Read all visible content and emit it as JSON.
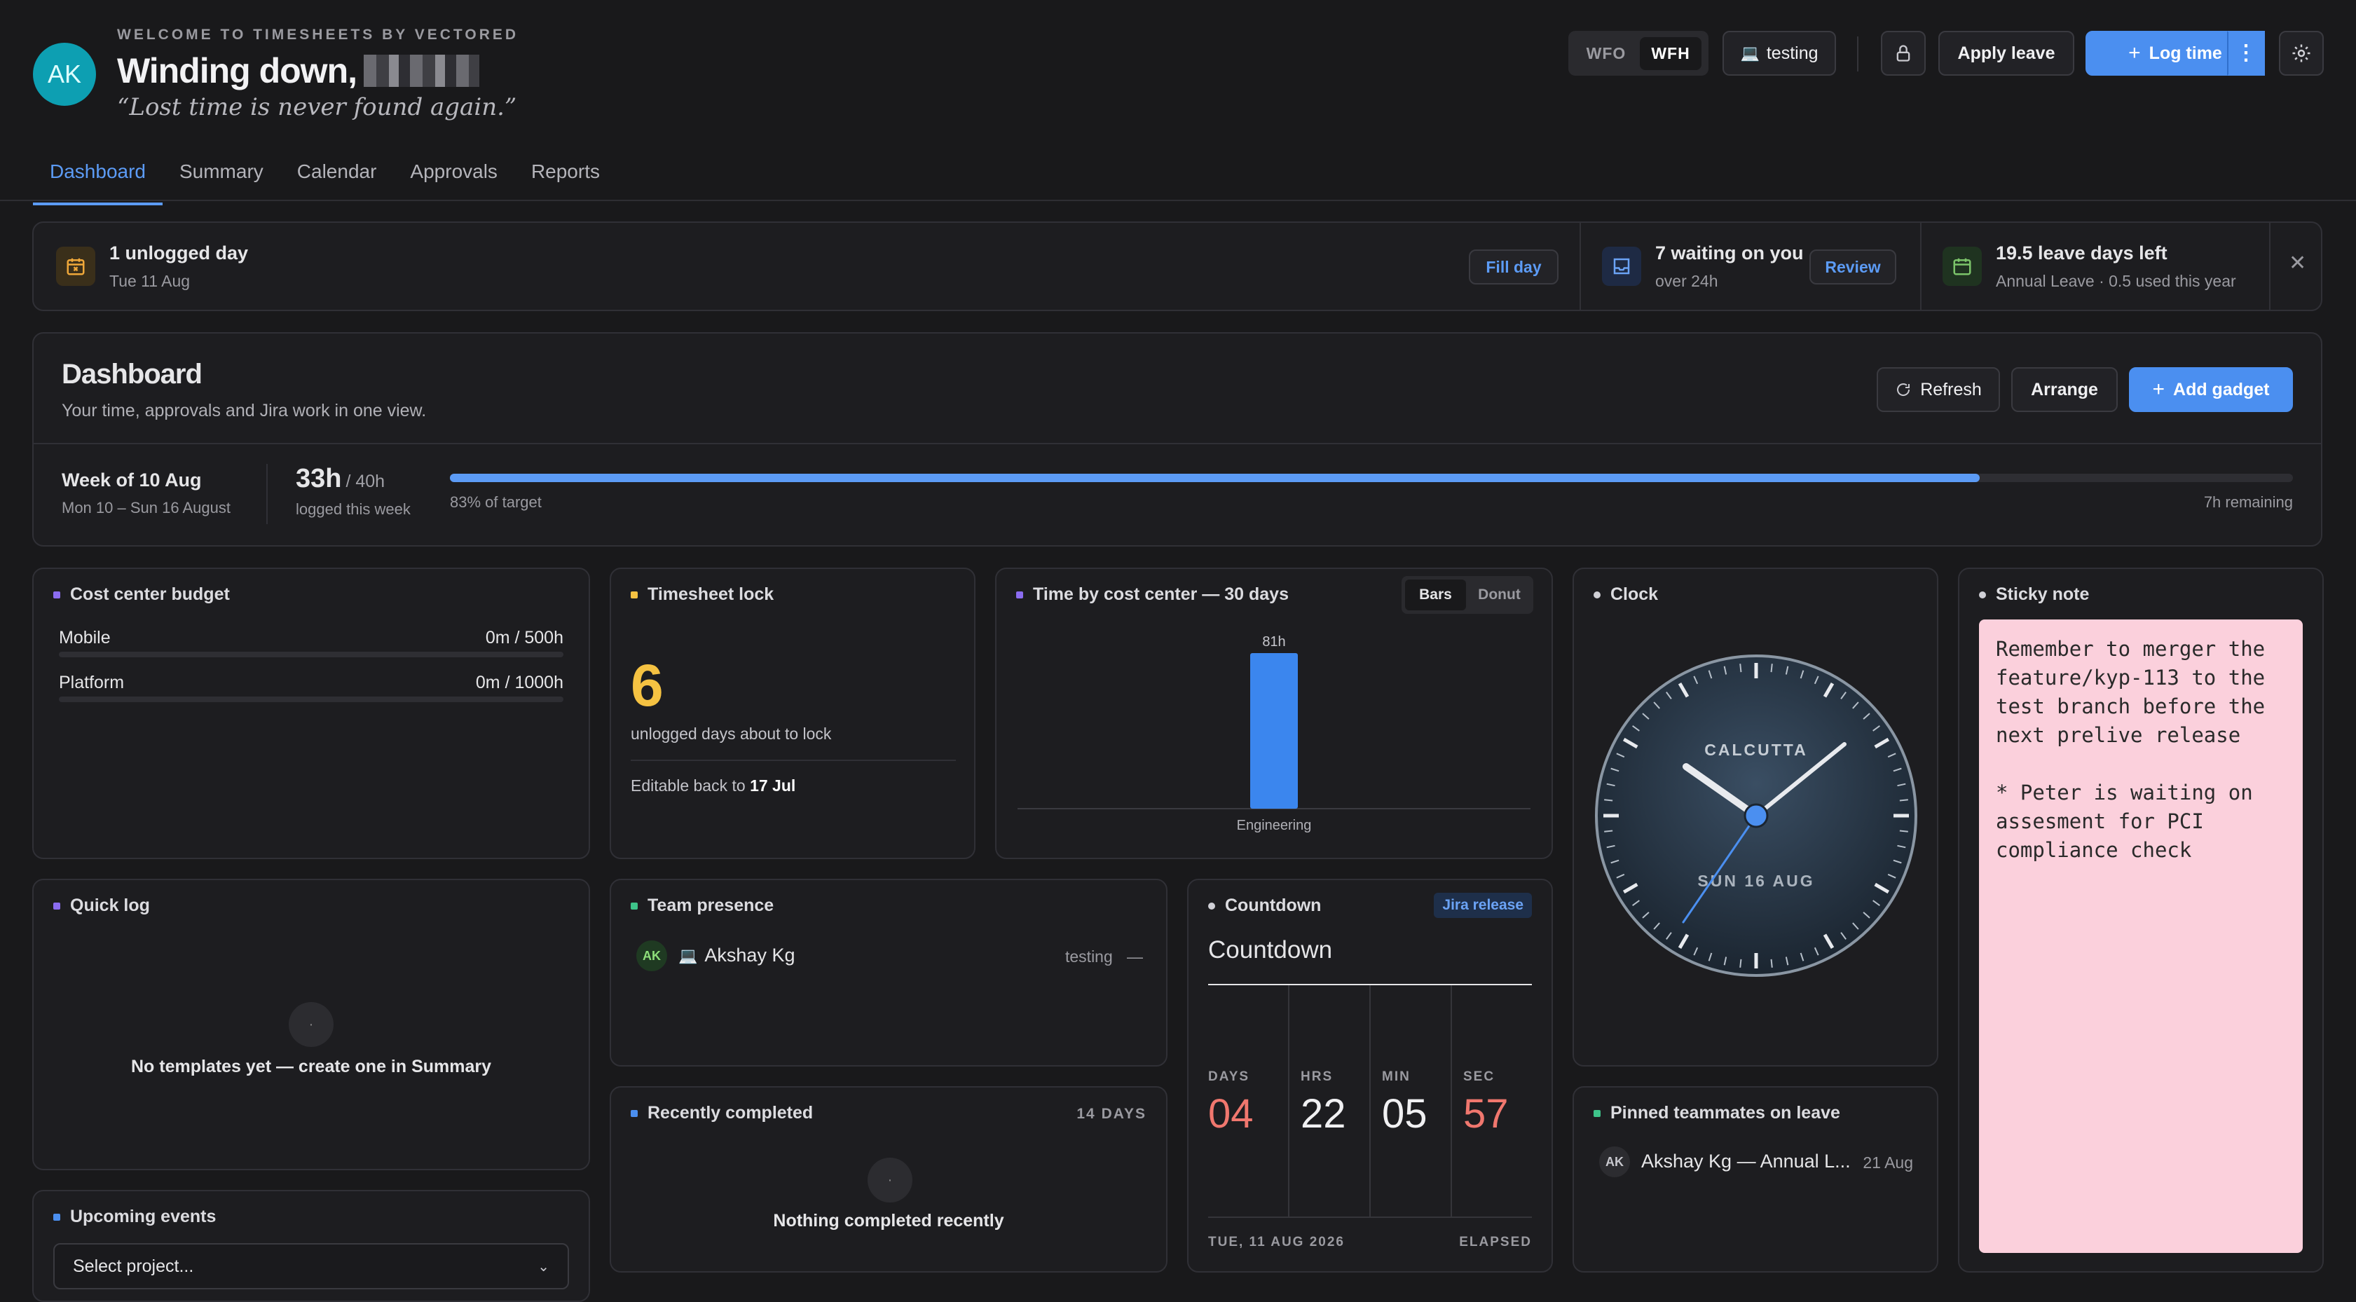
{
  "header": {
    "welcome": "WELCOME TO TIMESHEETS BY VECTORED",
    "greeting": "Winding down,",
    "quote": "“Lost time is never found again.”",
    "avatar_initials": "AK",
    "mode_options": [
      "WFO",
      "WFH"
    ],
    "mode_selected": "WFH",
    "location_label": "testing",
    "apply_leave": "Apply leave",
    "log_time": "Log time"
  },
  "tabs": [
    "Dashboard",
    "Summary",
    "Calendar",
    "Approvals",
    "Reports"
  ],
  "alerts": {
    "unlogged_title": "1 unlogged day",
    "unlogged_sub": "Tue 11 Aug",
    "fill_day": "Fill day",
    "waiting_title": "7 waiting on you",
    "waiting_sub": "over 24h",
    "review": "Review",
    "leave_title": "19.5 leave days left",
    "leave_sub": "Annual Leave · 0.5 used this year"
  },
  "dashboard": {
    "title": "Dashboard",
    "subtitle": "Your time, approvals and Jira work in one view.",
    "refresh": "Refresh",
    "arrange": "Arrange",
    "add_gadget": "Add gadget",
    "week_title": "Week of 10 Aug",
    "week_range": "Mon 10 – Sun 16 August",
    "hours_logged": "33h",
    "hours_target": "/ 40h",
    "logged_caption": "logged this week",
    "progress_fraction": 0.83,
    "progress_label": "83% of target",
    "remaining": "7h remaining"
  },
  "cost_center": {
    "title": "Cost center budget",
    "rows": [
      {
        "name": "Mobile",
        "value": "0m / 500h"
      },
      {
        "name": "Platform",
        "value": "0m / 1000h"
      }
    ]
  },
  "timesheet_lock": {
    "title": "Timesheet lock",
    "count": "6",
    "caption": "unlogged days about to lock",
    "editable_prefix": "Editable back to",
    "editable_date": "17 Jul"
  },
  "time_by_cc": {
    "title": "Time by cost center — 30 days",
    "toggle": [
      "Bars",
      "Donut"
    ],
    "toggle_selected": "Bars"
  },
  "chart_data": {
    "type": "bar",
    "categories": [
      "Engineering"
    ],
    "values": [
      81
    ],
    "data_labels": [
      "81h"
    ],
    "ylim": [
      0,
      81
    ]
  },
  "clock": {
    "title": "Clock",
    "city": "CALCUTTA",
    "date": "SUN 16 AUG"
  },
  "sticky": {
    "title": "Sticky note",
    "text": "Remember to merger the feature/kyp-113 to the test branch before the next prelive release\n\n* Peter is waiting on assesment for PCI compliance check",
    "color": "#fbd0dc"
  },
  "quick_log": {
    "title": "Quick log",
    "empty": "No templates yet — create one in Summary"
  },
  "team_presence": {
    "title": "Team presence",
    "member_initials": "AK",
    "member_name": "Akshay Kg",
    "member_status": "testing",
    "member_dash": "—"
  },
  "countdown": {
    "title": "Countdown",
    "badge": "Jira release",
    "heading": "Countdown",
    "units": [
      {
        "label": "DAYS",
        "value": "04"
      },
      {
        "label": "HRS",
        "value": "22"
      },
      {
        "label": "MIN",
        "value": "05"
      },
      {
        "label": "SEC",
        "value": "57"
      }
    ],
    "date": "TUE, 11 AUG 2026",
    "state": "ELAPSED"
  },
  "pinned": {
    "title": "Pinned teammates on leave",
    "initials": "AK",
    "entry": "Akshay Kg — Annual L...",
    "date": "21 Aug"
  },
  "recently_completed": {
    "title": "Recently completed",
    "range": "14 DAYS",
    "empty": "Nothing completed recently"
  },
  "upcoming": {
    "title": "Upcoming events",
    "select_placeholder": "Select project..."
  },
  "colors": {
    "accent": "#4b8ff0",
    "warning": "#f5c242",
    "danger": "#f0776e",
    "purple": "#8b6cf0",
    "green": "#3ec48a"
  }
}
